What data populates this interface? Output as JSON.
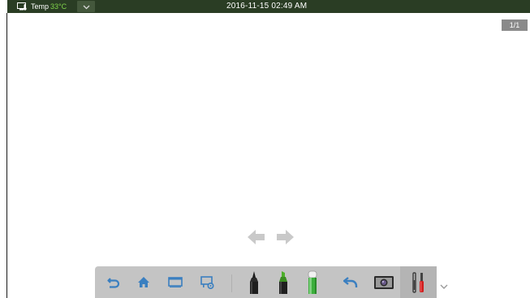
{
  "status_bar": {
    "temp_label": "Temp",
    "temp_value": "33°C",
    "datetime": "2016-11-15 02:49 AM"
  },
  "page_indicator": "1/1",
  "toolbar": {
    "tools": [
      {
        "name": "undo-button",
        "icon": "undo-icon"
      },
      {
        "name": "home-button",
        "icon": "home-icon"
      },
      {
        "name": "window-button",
        "icon": "window-icon"
      },
      {
        "name": "screen-settings-button",
        "icon": "screen-gear-icon"
      },
      {
        "name": "pen-button",
        "icon": "pen-icon"
      },
      {
        "name": "highlighter-button",
        "icon": "highlighter-icon"
      },
      {
        "name": "eraser-button",
        "icon": "eraser-icon"
      },
      {
        "name": "return-button",
        "icon": "return-arrow-icon"
      },
      {
        "name": "camera-button",
        "icon": "camera-icon"
      },
      {
        "name": "settings-button",
        "icon": "tools-icon"
      }
    ]
  },
  "colors": {
    "status_bar_bg": "#2a3d24",
    "temp_value": "#7fd34a",
    "toolbar_bg": "#c4c4c4",
    "icon_blue": "#3a7fc0",
    "pen_green": "#4caf2a"
  }
}
